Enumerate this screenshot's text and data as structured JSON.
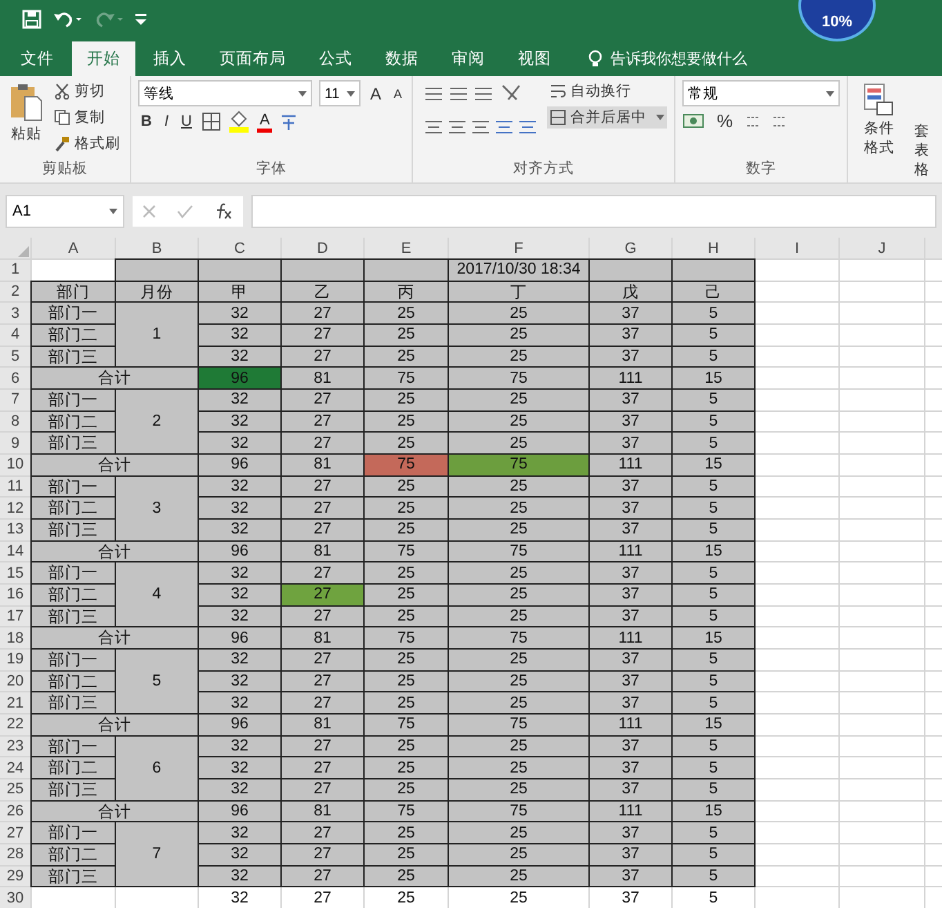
{
  "quick_access": {
    "redo_disabled": true
  },
  "speed_ball": {
    "text": "10%"
  },
  "tabs": [
    {
      "label": "文件",
      "selected": false
    },
    {
      "label": "开始",
      "selected": true
    },
    {
      "label": "插入",
      "selected": false
    },
    {
      "label": "页面布局",
      "selected": false
    },
    {
      "label": "公式",
      "selected": false
    },
    {
      "label": "数据",
      "selected": false
    },
    {
      "label": "审阅",
      "selected": false
    },
    {
      "label": "视图",
      "selected": false
    }
  ],
  "tell_me": "告诉我你想要做什么",
  "clipboard": {
    "paste": "粘贴",
    "cut": "剪切",
    "copy": "复制",
    "format_painter": "格式刷",
    "label": "剪贴板"
  },
  "font": {
    "name": "等线",
    "size": "11",
    "grow": "A",
    "shrink": "A",
    "bold": "B",
    "italic": "I",
    "underline": "U",
    "font_color": "A",
    "label": "字体"
  },
  "alignment": {
    "wrap": "自动换行",
    "merge": "合并后居中",
    "label": "对齐方式"
  },
  "number": {
    "format": "常规",
    "percent": "%",
    "label": "数字"
  },
  "styles": {
    "conditional": "条件格式",
    "table_top": "套",
    "table_bottom": "表格"
  },
  "name_box": "A1",
  "sheet": {
    "columns": [
      "A",
      "B",
      "C",
      "D",
      "E",
      "F",
      "G",
      "H",
      "I",
      "J"
    ],
    "rows": [
      {
        "n": "1",
        "shaded": true,
        "cells": [
          {
            "shaded": false
          },
          {},
          {},
          {},
          {},
          {
            "text": "2017/10/30 18:34"
          },
          {},
          {}
        ]
      },
      {
        "n": "2",
        "shaded": true,
        "cells": [
          {
            "text": "部门"
          },
          {
            "text": "月份"
          },
          {
            "text": "甲"
          },
          {
            "text": "乙"
          },
          {
            "text": "丙"
          },
          {
            "text": "丁"
          },
          {
            "text": "戊"
          },
          {
            "text": "己"
          }
        ]
      },
      {
        "n": "3",
        "shaded": true,
        "cells": [
          {
            "text": "部门一"
          },
          {
            "kind": "month_top"
          },
          {
            "text": "32"
          },
          {
            "text": "27"
          },
          {
            "text": "25"
          },
          {
            "text": "25"
          },
          {
            "text": "37"
          },
          {
            "text": "5"
          }
        ]
      },
      {
        "n": "4",
        "shaded": true,
        "cells": [
          {
            "text": "部门二"
          },
          {
            "text": "1",
            "kind": "month_mid"
          },
          {
            "text": "32"
          },
          {
            "text": "27"
          },
          {
            "text": "25"
          },
          {
            "text": "25"
          },
          {
            "text": "37"
          },
          {
            "text": "5"
          }
        ]
      },
      {
        "n": "5",
        "shaded": true,
        "cells": [
          {
            "text": "部门三"
          },
          {
            "kind": "month_bottom"
          },
          {
            "text": "32"
          },
          {
            "text": "27"
          },
          {
            "text": "25"
          },
          {
            "text": "25"
          },
          {
            "text": "37"
          },
          {
            "text": "5"
          }
        ]
      },
      {
        "n": "6",
        "shaded": true,
        "cells": [
          {
            "text": "合计",
            "kind": "total"
          },
          {
            "text": "96",
            "color": "#1f7a36"
          },
          {
            "text": "81"
          },
          {
            "text": "75"
          },
          {
            "text": "75"
          },
          {
            "text": "111"
          },
          {
            "text": "15"
          }
        ]
      },
      {
        "n": "7",
        "shaded": true,
        "cells": [
          {
            "text": "部门一"
          },
          {
            "kind": "month_top"
          },
          {
            "text": "32"
          },
          {
            "text": "27"
          },
          {
            "text": "25"
          },
          {
            "text": "25"
          },
          {
            "text": "37"
          },
          {
            "text": "5"
          }
        ]
      },
      {
        "n": "8",
        "shaded": true,
        "cells": [
          {
            "text": "部门二"
          },
          {
            "text": "2",
            "kind": "month_mid"
          },
          {
            "text": "32"
          },
          {
            "text": "27"
          },
          {
            "text": "25"
          },
          {
            "text": "25"
          },
          {
            "text": "37"
          },
          {
            "text": "5"
          }
        ]
      },
      {
        "n": "9",
        "shaded": true,
        "cells": [
          {
            "text": "部门三"
          },
          {
            "kind": "month_bottom"
          },
          {
            "text": "32"
          },
          {
            "text": "27"
          },
          {
            "text": "25"
          },
          {
            "text": "25"
          },
          {
            "text": "37"
          },
          {
            "text": "5"
          }
        ]
      },
      {
        "n": "10",
        "shaded": true,
        "cells": [
          {
            "text": "合计",
            "kind": "total"
          },
          {
            "text": "96"
          },
          {
            "text": "81"
          },
          {
            "text": "75",
            "color": "#c4695a"
          },
          {
            "text": "75",
            "color": "#6c9e3e"
          },
          {
            "text": "111"
          },
          {
            "text": "15"
          }
        ]
      },
      {
        "n": "11",
        "shaded": true,
        "cells": [
          {
            "text": "部门一"
          },
          {
            "kind": "month_top"
          },
          {
            "text": "32"
          },
          {
            "text": "27"
          },
          {
            "text": "25"
          },
          {
            "text": "25"
          },
          {
            "text": "37"
          },
          {
            "text": "5"
          }
        ]
      },
      {
        "n": "12",
        "shaded": true,
        "cells": [
          {
            "text": "部门二"
          },
          {
            "text": "3",
            "kind": "month_mid"
          },
          {
            "text": "32"
          },
          {
            "text": "27"
          },
          {
            "text": "25"
          },
          {
            "text": "25"
          },
          {
            "text": "37"
          },
          {
            "text": "5"
          }
        ]
      },
      {
        "n": "13",
        "shaded": true,
        "cells": [
          {
            "text": "部门三"
          },
          {
            "kind": "month_bottom"
          },
          {
            "text": "32"
          },
          {
            "text": "27"
          },
          {
            "text": "25"
          },
          {
            "text": "25"
          },
          {
            "text": "37"
          },
          {
            "text": "5"
          }
        ]
      },
      {
        "n": "14",
        "shaded": true,
        "cells": [
          {
            "text": "合计",
            "kind": "total"
          },
          {
            "text": "96"
          },
          {
            "text": "81"
          },
          {
            "text": "75"
          },
          {
            "text": "75"
          },
          {
            "text": "111"
          },
          {
            "text": "15"
          }
        ]
      },
      {
        "n": "15",
        "shaded": true,
        "cells": [
          {
            "text": "部门一"
          },
          {
            "kind": "month_top"
          },
          {
            "text": "32"
          },
          {
            "text": "27"
          },
          {
            "text": "25"
          },
          {
            "text": "25"
          },
          {
            "text": "37"
          },
          {
            "text": "5"
          }
        ]
      },
      {
        "n": "16",
        "shaded": true,
        "cells": [
          {
            "text": "部门二"
          },
          {
            "text": "4",
            "kind": "month_mid"
          },
          {
            "text": "32"
          },
          {
            "text": "27",
            "color": "#6fa33f"
          },
          {
            "text": "25"
          },
          {
            "text": "25"
          },
          {
            "text": "37"
          },
          {
            "text": "5"
          }
        ]
      },
      {
        "n": "17",
        "shaded": true,
        "cells": [
          {
            "text": "部门三"
          },
          {
            "kind": "month_bottom"
          },
          {
            "text": "32"
          },
          {
            "text": "27"
          },
          {
            "text": "25"
          },
          {
            "text": "25"
          },
          {
            "text": "37"
          },
          {
            "text": "5"
          }
        ]
      },
      {
        "n": "18",
        "shaded": true,
        "cells": [
          {
            "text": "合计",
            "kind": "total"
          },
          {
            "text": "96"
          },
          {
            "text": "81"
          },
          {
            "text": "75"
          },
          {
            "text": "75"
          },
          {
            "text": "111"
          },
          {
            "text": "15"
          }
        ]
      },
      {
        "n": "19",
        "shaded": true,
        "cells": [
          {
            "text": "部门一"
          },
          {
            "kind": "month_top"
          },
          {
            "text": "32"
          },
          {
            "text": "27"
          },
          {
            "text": "25"
          },
          {
            "text": "25"
          },
          {
            "text": "37"
          },
          {
            "text": "5"
          }
        ]
      },
      {
        "n": "20",
        "shaded": true,
        "cells": [
          {
            "text": "部门二"
          },
          {
            "text": "5",
            "kind": "month_mid"
          },
          {
            "text": "32"
          },
          {
            "text": "27"
          },
          {
            "text": "25"
          },
          {
            "text": "25"
          },
          {
            "text": "37"
          },
          {
            "text": "5"
          }
        ]
      },
      {
        "n": "21",
        "shaded": true,
        "cells": [
          {
            "text": "部门三"
          },
          {
            "kind": "month_bottom"
          },
          {
            "text": "32"
          },
          {
            "text": "27"
          },
          {
            "text": "25"
          },
          {
            "text": "25"
          },
          {
            "text": "37"
          },
          {
            "text": "5"
          }
        ]
      },
      {
        "n": "22",
        "shaded": true,
        "cells": [
          {
            "text": "合计",
            "kind": "total"
          },
          {
            "text": "96"
          },
          {
            "text": "81"
          },
          {
            "text": "75"
          },
          {
            "text": "75"
          },
          {
            "text": "111"
          },
          {
            "text": "15"
          }
        ]
      },
      {
        "n": "23",
        "shaded": true,
        "cells": [
          {
            "text": "部门一"
          },
          {
            "kind": "month_top"
          },
          {
            "text": "32"
          },
          {
            "text": "27"
          },
          {
            "text": "25"
          },
          {
            "text": "25"
          },
          {
            "text": "37"
          },
          {
            "text": "5"
          }
        ]
      },
      {
        "n": "24",
        "shaded": true,
        "cells": [
          {
            "text": "部门二"
          },
          {
            "text": "6",
            "kind": "month_mid"
          },
          {
            "text": "32"
          },
          {
            "text": "27"
          },
          {
            "text": "25"
          },
          {
            "text": "25"
          },
          {
            "text": "37"
          },
          {
            "text": "5"
          }
        ]
      },
      {
        "n": "25",
        "shaded": true,
        "cells": [
          {
            "text": "部门三"
          },
          {
            "kind": "month_bottom"
          },
          {
            "text": "32"
          },
          {
            "text": "27"
          },
          {
            "text": "25"
          },
          {
            "text": "25"
          },
          {
            "text": "37"
          },
          {
            "text": "5"
          }
        ]
      },
      {
        "n": "26",
        "shaded": true,
        "cells": [
          {
            "text": "合计",
            "kind": "total"
          },
          {
            "text": "96"
          },
          {
            "text": "81"
          },
          {
            "text": "75"
          },
          {
            "text": "75"
          },
          {
            "text": "111"
          },
          {
            "text": "15"
          }
        ]
      },
      {
        "n": "27",
        "shaded": true,
        "cells": [
          {
            "text": "部门一"
          },
          {
            "kind": "month_top"
          },
          {
            "text": "32"
          },
          {
            "text": "27"
          },
          {
            "text": "25"
          },
          {
            "text": "25"
          },
          {
            "text": "37"
          },
          {
            "text": "5"
          }
        ]
      },
      {
        "n": "28",
        "shaded": true,
        "cells": [
          {
            "text": "部门二"
          },
          {
            "text": "7",
            "kind": "month_mid"
          },
          {
            "text": "32"
          },
          {
            "text": "27"
          },
          {
            "text": "25"
          },
          {
            "text": "25"
          },
          {
            "text": "37"
          },
          {
            "text": "5"
          }
        ]
      },
      {
        "n": "29",
        "shaded": true,
        "cells": [
          {
            "text": "部门三"
          },
          {
            "kind": "month_bottom"
          },
          {
            "text": "32"
          },
          {
            "text": "27"
          },
          {
            "text": "25"
          },
          {
            "text": "25"
          },
          {
            "text": "37"
          },
          {
            "text": "5"
          }
        ]
      },
      {
        "n": "30",
        "shaded": false,
        "cells": [
          {},
          {},
          {
            "text": "32"
          },
          {
            "text": "27"
          },
          {
            "text": "25"
          },
          {
            "text": "25"
          },
          {
            "text": "37"
          },
          {
            "text": "5"
          }
        ]
      }
    ]
  }
}
